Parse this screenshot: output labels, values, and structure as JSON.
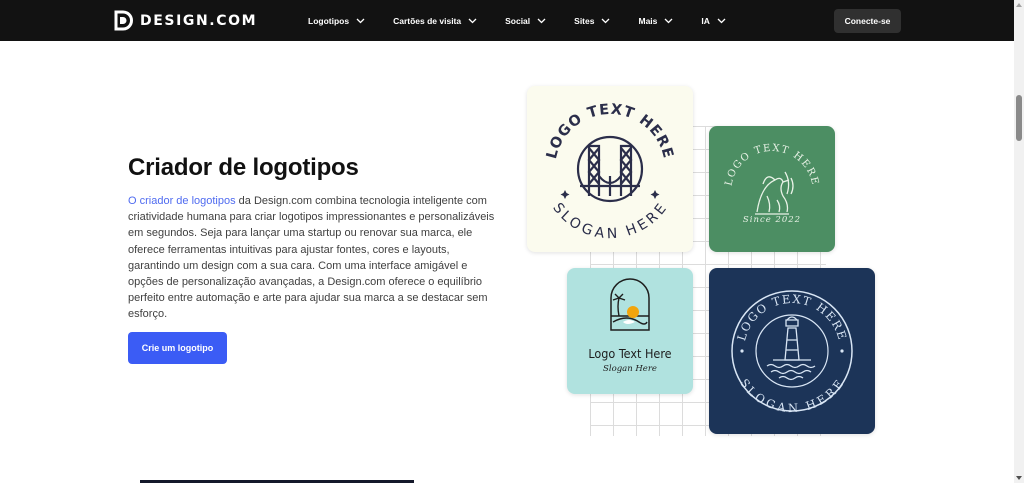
{
  "brand": {
    "name": "DESIGN.COM"
  },
  "nav": {
    "items": [
      {
        "label": "Logotipos"
      },
      {
        "label": "Cartões de visita"
      },
      {
        "label": "Social"
      },
      {
        "label": "Sites"
      },
      {
        "label": "Mais"
      },
      {
        "label": "IA"
      }
    ],
    "connect_label": "Conecte-se"
  },
  "hero": {
    "title": "Criador de logotipos",
    "link_text": "O criador de logotipos",
    "description": " da Design.com combina tecnologia inteligente com criatividade humana para criar logotipos impressionantes e personalizáveis em segundos. Seja para lançar uma startup ou renovar sua marca, ele oferece ferramentas intuitivas para ajustar fontes, cores e layouts, garantindo um design com a sua cara. Com uma interface amigável e opções de personalização avançadas, a Design.com oferece o equilíbrio perfeito entre automação e arte para ajudar sua marca a se destacar sem esforço.",
    "cta_label": "Crie um logotipo"
  },
  "logos": {
    "card1": {
      "top": "LOGO TEXT HERE",
      "bottom": "SLOGAN HERE"
    },
    "card2": {
      "top": "LOGO TEXT HERE",
      "bottom": "Since 2022"
    },
    "card3": {
      "title": "Logo Text Here",
      "slogan": "Slogan Here"
    },
    "card4": {
      "top": "LOGO TEXT HERE",
      "bottom": "SLOGAN HERE"
    }
  },
  "colors": {
    "nav_bg": "#121212",
    "accent": "#3b5cf5",
    "link": "#4f6bf0",
    "card1_bg": "#fbfbee",
    "card2_bg": "#4c8e63",
    "card3_bg": "#b0e2df",
    "card4_bg": "#1c3458"
  }
}
